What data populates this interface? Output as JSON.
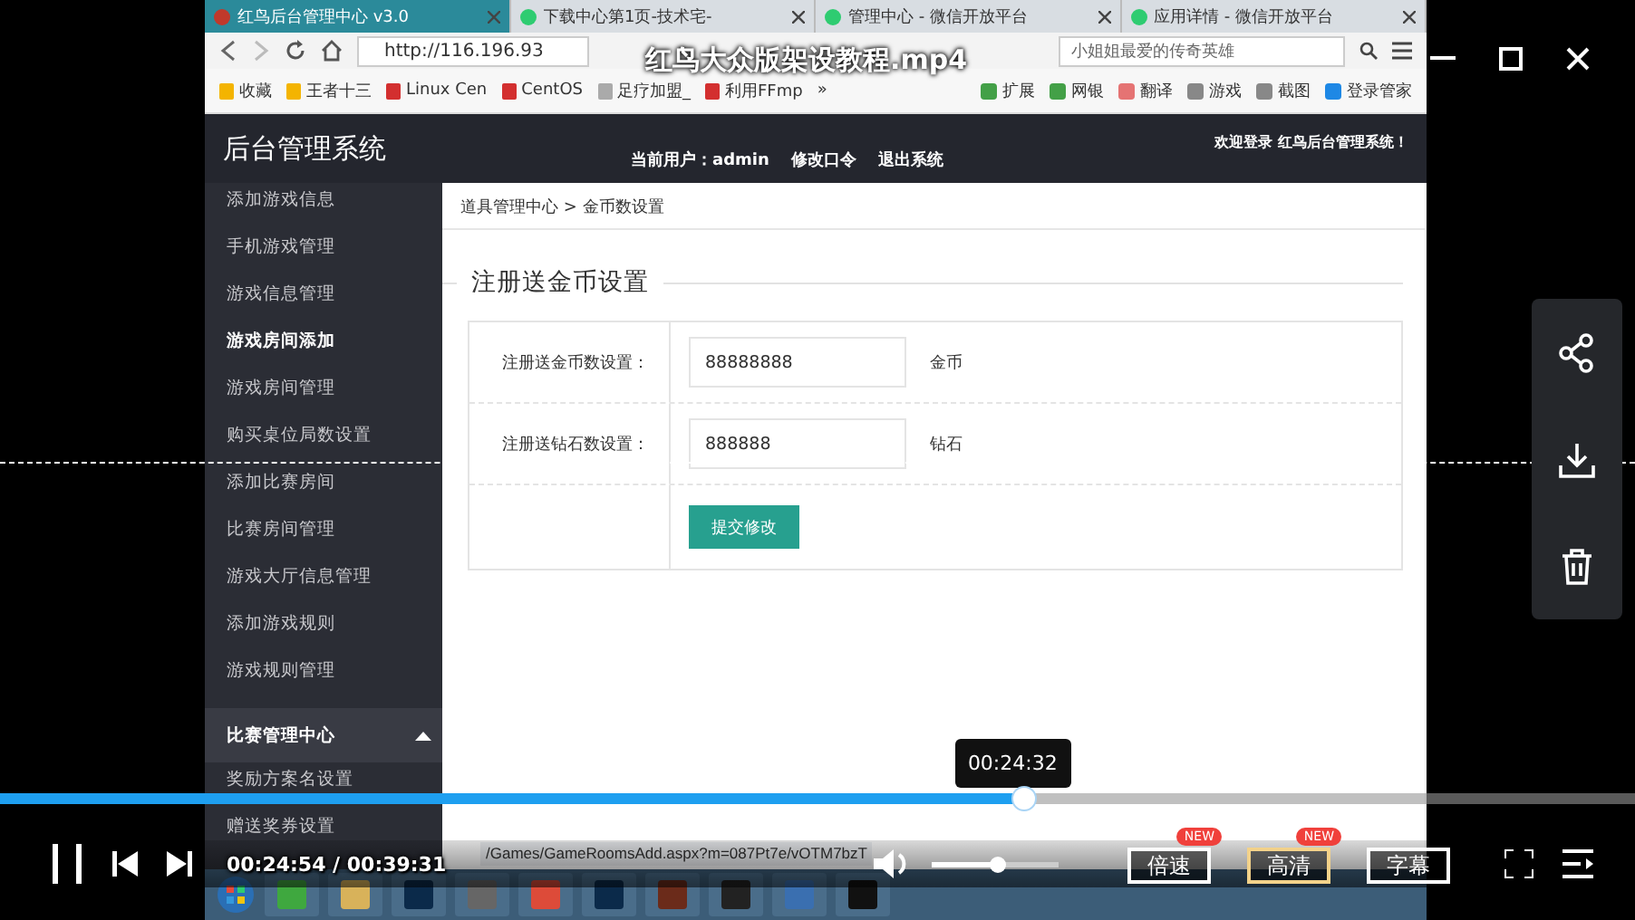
{
  "player": {
    "title": "红鸟大众版架设教程.mp4",
    "playing": true,
    "tooltip": "00:24:32",
    "time": "00:24:54 / 00:39:31",
    "progress": {
      "level": 0.626
    },
    "volume": {
      "level": 0.51
    },
    "buttons": [
      {
        "label": "倍速",
        "badge": "NEW",
        "selected": false
      },
      {
        "label": "高清",
        "badge": "NEW",
        "selected": true
      },
      {
        "label": "字幕",
        "selected": false
      }
    ]
  },
  "recording": {
    "browser": {
      "tabs": [
        {
          "title": "红鸟后台管理中心 v3.0",
          "selected": true
        },
        {
          "title": "下载中心第1页-技术宅-",
          "selected": false
        },
        {
          "title": "管理中心 - 微信开放平台",
          "selected": false
        },
        {
          "title": "应用详情 - 微信开放平台",
          "selected": false
        }
      ],
      "address": "http://116.196.93",
      "search": "小姐姐最爱的传奇英雄",
      "bookmarks": [
        "收藏",
        "王者十三",
        "Linux Cen",
        "CentOS",
        "足疗加盟_",
        "利用FFmp",
        "»"
      ],
      "bookmarks_right": [
        "扩展",
        "网银",
        "翻译",
        "游戏",
        "截图",
        "登录管家"
      ]
    },
    "app": {
      "title": "后台管理系统",
      "current_user": "当前用户：admin",
      "links": [
        "修改口令",
        "退出系统"
      ],
      "welcome": "欢迎登录 红鸟后台管理系统！",
      "sidebar": [
        {
          "kind": "item",
          "label": "添加游戏信息",
          "hovered": false
        },
        {
          "kind": "item",
          "label": "手机游戏管理",
          "hovered": false
        },
        {
          "kind": "item",
          "label": "游戏信息管理",
          "hovered": false
        },
        {
          "kind": "item",
          "label": "游戏房间添加",
          "hovered": true
        },
        {
          "kind": "item",
          "label": "游戏房间管理",
          "hovered": false
        },
        {
          "kind": "item",
          "label": "购买桌位局数设置",
          "hovered": false
        },
        {
          "kind": "item",
          "label": "添加比赛房间",
          "hovered": false
        },
        {
          "kind": "item",
          "label": "比赛房间管理",
          "hovered": false
        },
        {
          "kind": "item",
          "label": "游戏大厅信息管理",
          "hovered": false
        },
        {
          "kind": "item",
          "label": "添加游戏规则",
          "hovered": false
        },
        {
          "kind": "item",
          "label": "游戏规则管理",
          "hovered": false
        },
        {
          "kind": "group",
          "label": "比赛管理中心",
          "expanded": true,
          "children": [
            {
              "kind": "item",
              "label": "奖励方案名设置",
              "hovered": false
            },
            {
              "kind": "item",
              "label": "赠送奖券设置",
              "hovered": false
            }
          ]
        }
      ],
      "breadcrumb": "道具管理中心 > 金币数设置",
      "section_title": "注册送金币设置",
      "form": [
        {
          "label": "注册送金币数设置：",
          "value": "88888888",
          "unit": "金币"
        },
        {
          "label": "注册送钻石数设置：",
          "value": "888888",
          "unit": "钻石"
        }
      ],
      "submit": "提交修改"
    },
    "status_bar": {
      "url": "/Games/GameRoomsAdd.aspx?m=087Pt7e/vOTM7bzT"
    }
  }
}
